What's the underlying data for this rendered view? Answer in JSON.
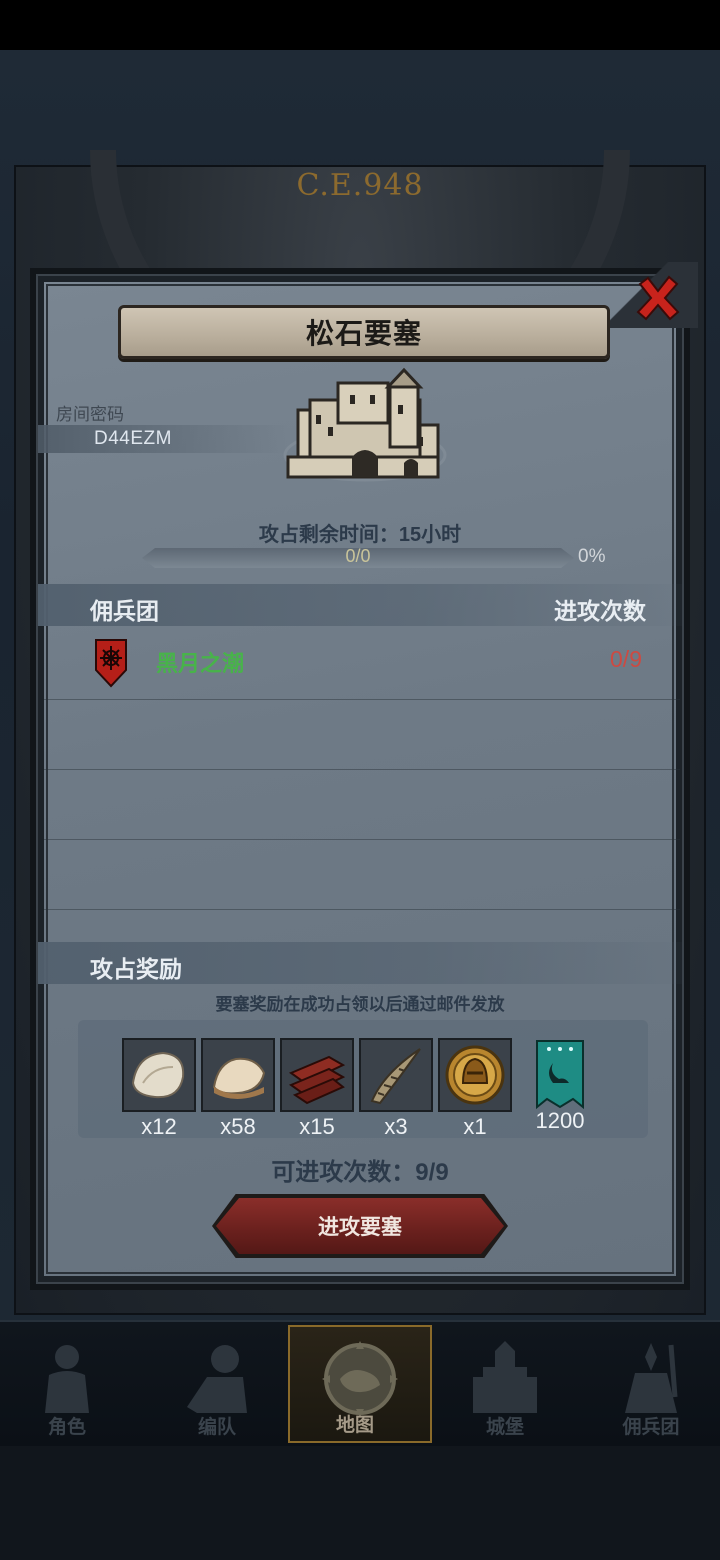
{
  "background": {
    "year_label": "C.E.948"
  },
  "dialog": {
    "title": "松石要塞",
    "room_code_label": "房间密码",
    "room_code": "D44EZM",
    "time_remaining": "攻占剩余时间：15小时",
    "progress": {
      "value_text": "0/0",
      "percent_text": "0%",
      "fraction": 0
    },
    "mercenary_section": {
      "left_header": "佣兵团",
      "right_header": "进攻次数",
      "rows": [
        {
          "name": "黑月之潮",
          "attacks": "0/9"
        }
      ]
    },
    "reward_section": {
      "header": "攻占奖励",
      "note": "要塞奖励在成功占领以后通过邮件发放",
      "items": [
        {
          "icon": "fur-pelt-icon",
          "qty": "x12"
        },
        {
          "icon": "fur-hide-icon",
          "qty": "x58"
        },
        {
          "icon": "wood-planks-icon",
          "qty": "x15"
        },
        {
          "icon": "horn-icon",
          "qty": "x3"
        },
        {
          "icon": "knight-coin-icon",
          "qty": "x1"
        },
        {
          "icon": "banner-icon",
          "qty": "1200"
        }
      ]
    },
    "attacks_left": "可进攻次数：9/9",
    "attack_button": "进攻要塞"
  },
  "navbar": {
    "items": [
      {
        "label": "角色",
        "icon": "character-icon",
        "active": false
      },
      {
        "label": "编队",
        "icon": "formation-icon",
        "active": false
      },
      {
        "label": "地图",
        "icon": "map-compass-icon",
        "active": true
      },
      {
        "label": "城堡",
        "icon": "castle-icon",
        "active": false
      },
      {
        "label": "佣兵团",
        "icon": "mercenary-icon",
        "active": false
      }
    ]
  },
  "colors": {
    "panel": "#6e7a86",
    "guild_name": "#48b34a",
    "attack_count": "#cc4a42",
    "button_red": "#6c211e",
    "nav_active_border": "#8a6a2a"
  }
}
